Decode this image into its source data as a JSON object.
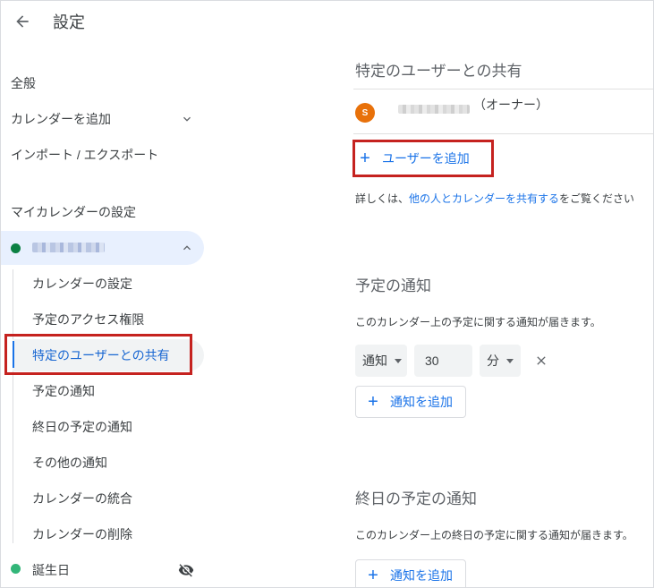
{
  "header": {
    "title": "設定"
  },
  "sidebar": {
    "general": "全般",
    "add_calendar": "カレンダーを追加",
    "import_export": "インポート / エクスポート",
    "my_calendars_heading": "マイカレンダーの設定",
    "calendar_color": "#0b8043",
    "sub_items": [
      "カレンダーの設定",
      "予定のアクセス権限",
      "特定のユーザーとの共有",
      "予定の通知",
      "終日の予定の通知",
      "その他の通知",
      "カレンダーの統合",
      "カレンダーの削除"
    ],
    "active_index": 2,
    "birthday": {
      "label": "誕生日",
      "color": "#33b679",
      "icon": "visibility-off-icon"
    }
  },
  "main": {
    "share": {
      "title": "特定のユーザーとの共有",
      "owner_initial": "S",
      "owner_role": "（オーナー）",
      "add_user": "ユーザーを追加",
      "help_prefix": "詳しくは、",
      "help_link": "他の人とカレンダーを共有する",
      "help_suffix": "をご覧ください"
    },
    "notifications": {
      "title": "予定の通知",
      "description": "このカレンダー上の予定に関する通知が届きます。",
      "type": "通知",
      "value": "30",
      "unit": "分",
      "add_label": "通知を追加"
    },
    "allday": {
      "title": "終日の予定の通知",
      "description": "このカレンダー上の終日の予定に関する通知が届きます。",
      "add_label": "通知を追加"
    }
  },
  "colors": {
    "accent": "#1a73e8",
    "highlight": "#c5221f",
    "avatar": "#e8710a"
  }
}
